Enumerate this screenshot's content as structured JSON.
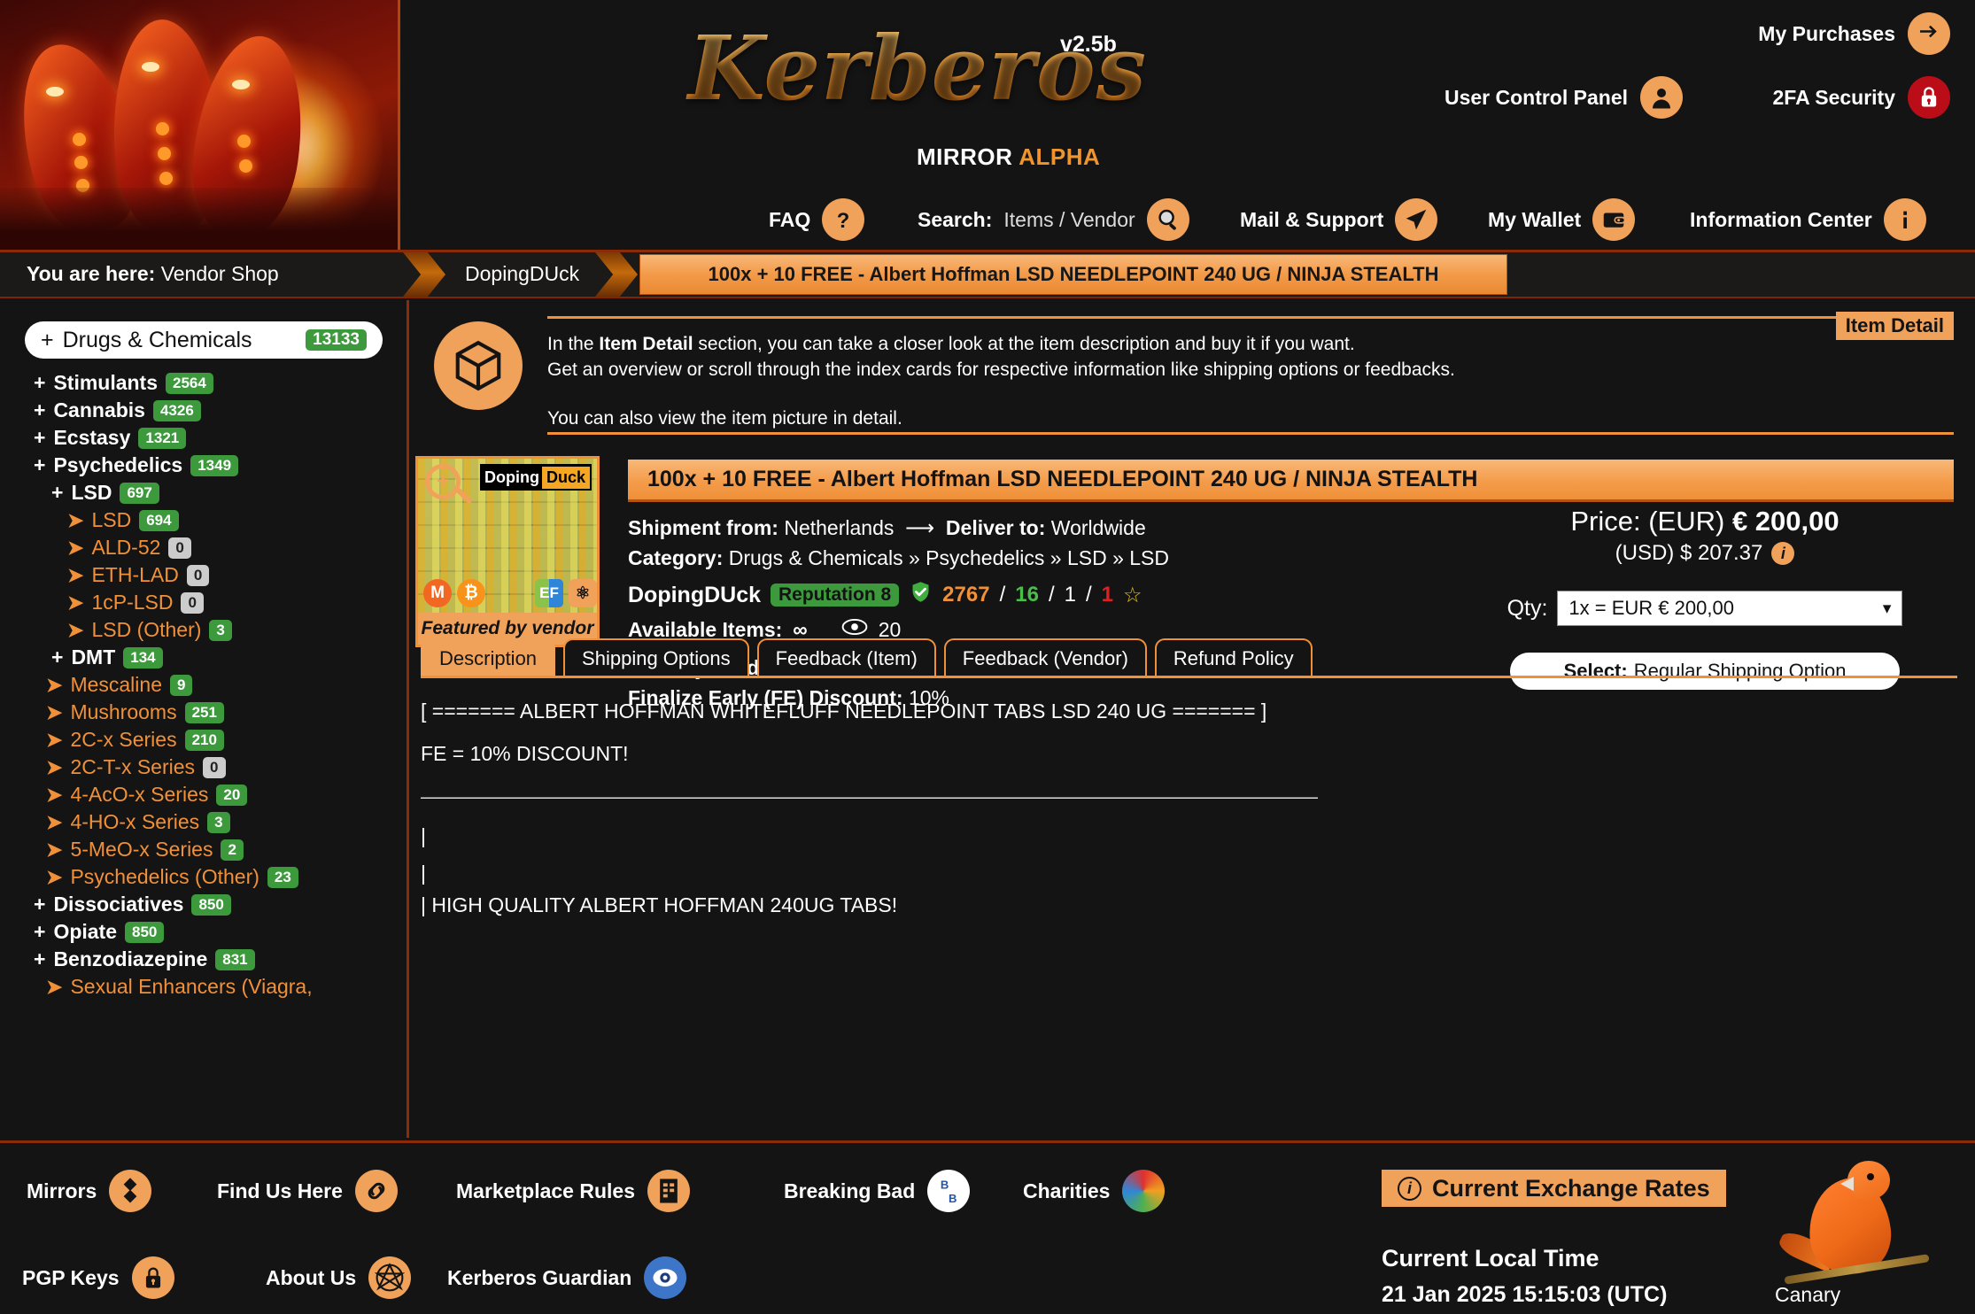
{
  "site": {
    "name": "Kerberos",
    "version": "v2.5b",
    "mirror_word": "MIRROR",
    "alpha_word": "ALPHA"
  },
  "header": {
    "my_purchases": "My Purchases",
    "user_control_panel": "User Control Panel",
    "twofa_security": "2FA Security",
    "nav": {
      "faq": "FAQ",
      "search_label": "Search:",
      "search_value": "Items / Vendor",
      "mail_support": "Mail & Support",
      "my_wallet": "My Wallet",
      "information_center": "Information Center"
    }
  },
  "breadcrumb": {
    "you_are_here": "You are here:",
    "root": "Vendor Shop",
    "vendor": "DopingDUck",
    "item": "100x + 10 FREE - Albert Hoffman LSD NEEDLEPOINT 240 UG / NINJA STEALTH"
  },
  "sidebar": {
    "root": {
      "prefix": "+",
      "label": "Drugs & Chemicals",
      "count": "13133"
    },
    "items": [
      {
        "level": 1,
        "prefix": "+",
        "label": "Stimulants",
        "count": "2564",
        "zero": false
      },
      {
        "level": 1,
        "prefix": "+",
        "label": "Cannabis",
        "count": "4326",
        "zero": false
      },
      {
        "level": 1,
        "prefix": "+",
        "label": "Ecstasy",
        "count": "1321",
        "zero": false
      },
      {
        "level": 1,
        "prefix": "+",
        "label": "Psychedelics",
        "count": "1349",
        "zero": false
      },
      {
        "level": 2,
        "prefix": "+",
        "label": "LSD",
        "count": "697",
        "zero": false
      },
      {
        "level": 3,
        "prefix": "➤",
        "label": "LSD",
        "count": "694",
        "zero": false
      },
      {
        "level": 3,
        "prefix": "➤",
        "label": "ALD-52",
        "count": "0",
        "zero": true
      },
      {
        "level": 3,
        "prefix": "➤",
        "label": "ETH-LAD",
        "count": "0",
        "zero": true
      },
      {
        "level": 3,
        "prefix": "➤",
        "label": "1cP-LSD",
        "count": "0",
        "zero": true
      },
      {
        "level": 3,
        "prefix": "➤",
        "label": "LSD (Other)",
        "count": "3",
        "zero": false
      },
      {
        "level": 2,
        "prefix": "+",
        "label": "DMT",
        "count": "134",
        "zero": false
      },
      {
        "level": 4,
        "prefix": "➤",
        "label": "Mescaline",
        "count": "9",
        "zero": false
      },
      {
        "level": 4,
        "prefix": "➤",
        "label": "Mushrooms",
        "count": "251",
        "zero": false
      },
      {
        "level": 4,
        "prefix": "➤",
        "label": "2C-x Series",
        "count": "210",
        "zero": false
      },
      {
        "level": 4,
        "prefix": "➤",
        "label": "2C-T-x Series",
        "count": "0",
        "zero": true
      },
      {
        "level": 4,
        "prefix": "➤",
        "label": "4-AcO-x Series",
        "count": "20",
        "zero": false
      },
      {
        "level": 4,
        "prefix": "➤",
        "label": "4-HO-x Series",
        "count": "3",
        "zero": false
      },
      {
        "level": 4,
        "prefix": "➤",
        "label": "5-MeO-x Series",
        "count": "2",
        "zero": false
      },
      {
        "level": 4,
        "prefix": "➤",
        "label": "Psychedelics (Other)",
        "count": "23",
        "zero": false
      },
      {
        "level": 1,
        "prefix": "+",
        "label": "Dissociatives",
        "count": "850",
        "zero": false
      },
      {
        "level": 1,
        "prefix": "+",
        "label": "Opiate",
        "count": "850",
        "zero": false
      },
      {
        "level": 1,
        "prefix": "+",
        "label": "Benzodiazepine",
        "count": "831",
        "zero": false
      },
      {
        "level": 4,
        "prefix": "➤",
        "label": "Sexual Enhancers (Viagra,",
        "count": "",
        "zero": false
      }
    ]
  },
  "info_panel": {
    "tag": "Item Detail",
    "line1_pre": "In the ",
    "line1_bold": "Item Detail",
    "line1_post": " section, you can take a closer look at the item description and buy it if you want.",
    "line2": "Get an overview or scroll through the index cards for respective information like shipping options or feedbacks.",
    "line3": "You can also view the item picture in detail."
  },
  "product": {
    "title": "100x + 10 FREE - Albert Hoffman LSD NEEDLEPOINT 240 UG / NINJA STEALTH",
    "thumb_vendor_a": "Doping",
    "thumb_vendor_b": "Duck",
    "featured_label": "Featured by vendor",
    "shipment_from_label": "Shipment from:",
    "shipment_from": "Netherlands",
    "deliver_to_label": "Deliver to:",
    "deliver_to": "Worldwide",
    "category_label": "Category:",
    "category": "Drugs & Chemicals » Psychedelics » LSD » LSD",
    "vendor": "DopingDUck",
    "reputation": "Reputation 8",
    "stat_total": "2767",
    "stat_green": "16",
    "stat_white": "1",
    "stat_red": "1",
    "star": "☆",
    "available_label": "Available Items:",
    "available_value": "∞",
    "views": "20",
    "offer_label": "Offer by vendor:",
    "offer_value": "Disabled",
    "fe_label": "Finalize Early (FE) Discount:",
    "fe_value": "10%",
    "price_label": "Price: (EUR)",
    "price_eur": "€ 200,00",
    "price_usd": "(USD) $ 207.37",
    "qty_label": "Qty:",
    "qty_value": "1x = EUR € 200,00",
    "shipping_button_bold": "Select:",
    "shipping_button_text": "Regular Shipping Option"
  },
  "tabs": [
    {
      "label": "Description",
      "active": true
    },
    {
      "label": "Shipping Options",
      "active": false
    },
    {
      "label": "Feedback (Item)",
      "active": false
    },
    {
      "label": "Feedback (Vendor)",
      "active": false
    },
    {
      "label": "Refund Policy",
      "active": false
    }
  ],
  "description": {
    "line1": "[ ======= ALBERT HOFFMAN WHITEFLUFF NEEDLEPOINT TABS LSD 240 UG ======= ]",
    "line2": "FE = 10% DISCOUNT!",
    "rule": "——————————————————————————————————————————————",
    "pipe1": "|",
    "pipe2": "|",
    "line_cut": "| HIGH QUALITY ALBERT HOFFMAN 240UG TABS!"
  },
  "footer": {
    "mirrors": "Mirrors",
    "find_us_here": "Find Us Here",
    "marketplace_rules": "Marketplace Rules",
    "breaking_bad": "Breaking Bad",
    "charities": "Charities",
    "pgp_keys": "PGP Keys",
    "about_us": "About Us",
    "kerberos_guardian": "Kerberos Guardian",
    "exchange_rates": "Current Exchange Rates",
    "clock_title": "Current Local Time",
    "clock_value": "21 Jan 2025 15:15:03 (UTC)",
    "canary": "Canary"
  },
  "colors": {
    "accent": "#f0a15a",
    "accent_dark": "#b6530c",
    "background": "#141414",
    "badge_green": "#3c9a3c",
    "badge_grey": "#cccccc",
    "alert_red": "#bb0d18"
  }
}
